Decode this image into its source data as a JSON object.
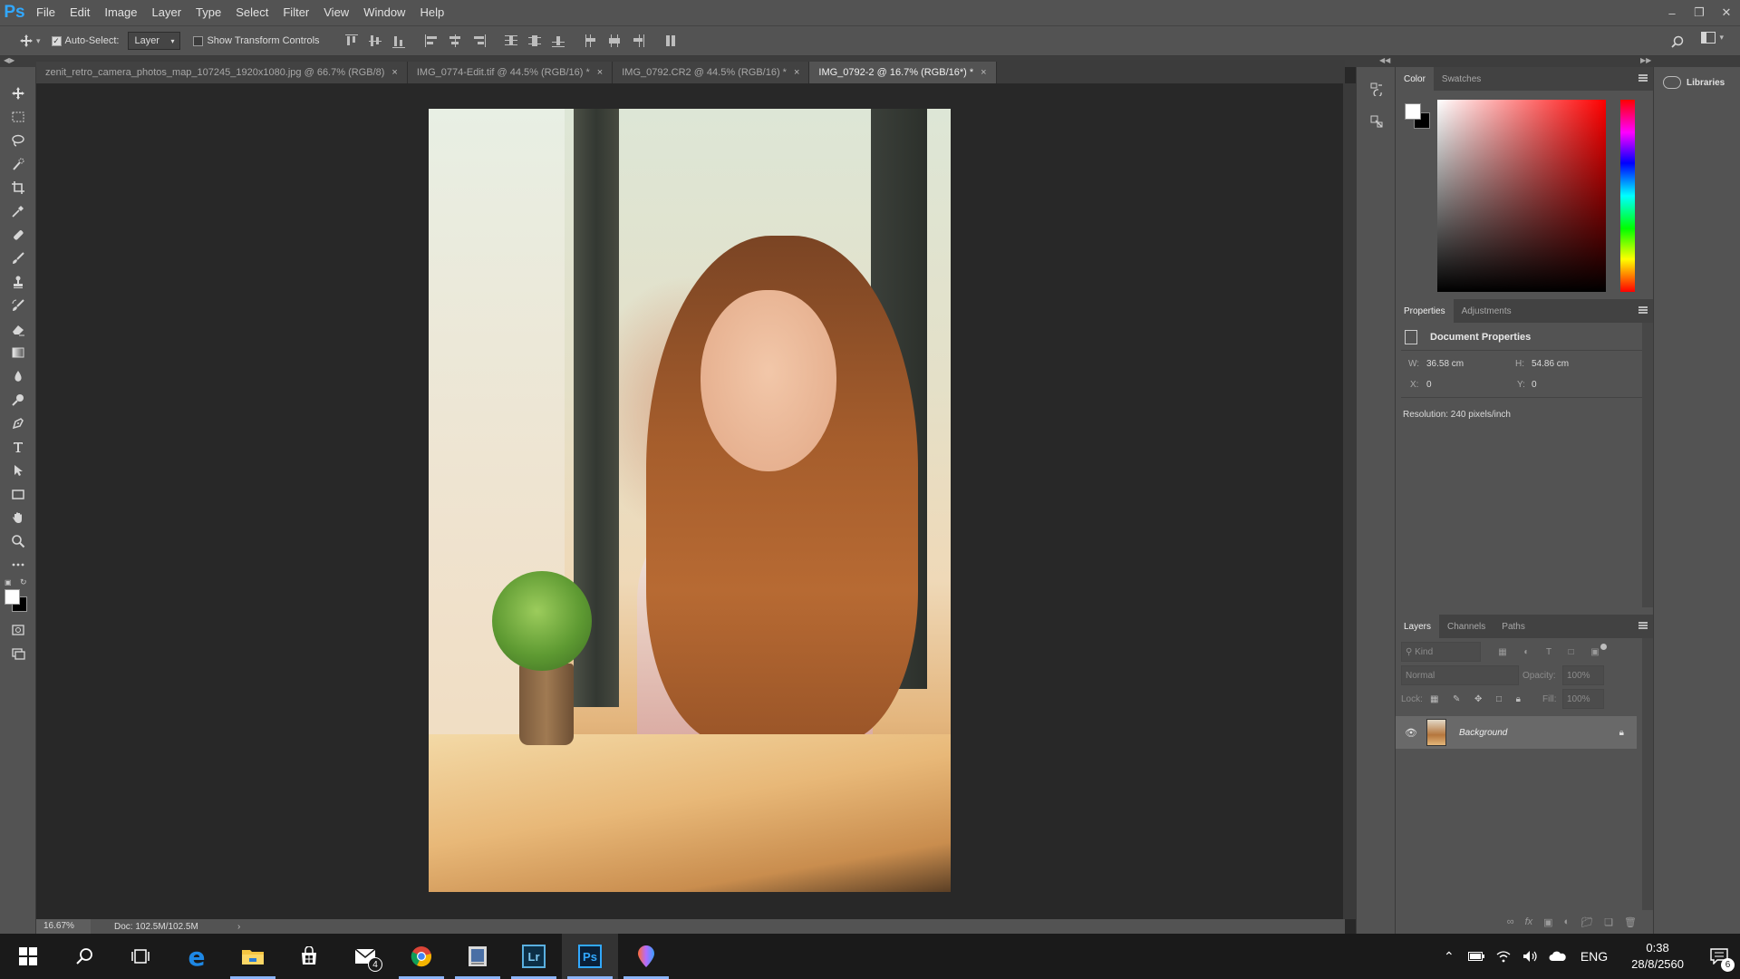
{
  "app": {
    "logo": "Ps"
  },
  "menu": [
    "File",
    "Edit",
    "Image",
    "Layer",
    "Type",
    "Select",
    "Filter",
    "View",
    "Window",
    "Help"
  ],
  "options": {
    "auto_select_label": "Auto-Select:",
    "auto_select_checked": true,
    "auto_select_target": "Layer",
    "show_transform_label": "Show Transform Controls",
    "show_transform_checked": false
  },
  "tabs": [
    {
      "label": "zenit_retro_camera_photos_map_107245_1920x1080.jpg @ 66.7% (RGB/8)",
      "active": false
    },
    {
      "label": "IMG_0774-Edit.tif @ 44.5% (RGB/16) *",
      "active": false
    },
    {
      "label": "IMG_0792.CR2 @ 44.5% (RGB/16) *",
      "active": false
    },
    {
      "label": "IMG_0792-2 @ 16.7% (RGB/16*) *",
      "active": true
    }
  ],
  "status": {
    "zoom": "16.67%",
    "doc": "Doc: 102.5M/102.5M"
  },
  "color_panel": {
    "tabs": [
      "Color",
      "Swatches"
    ],
    "foreground": "#ffffff",
    "background": "#000000"
  },
  "properties_panel": {
    "tabs": [
      "Properties",
      "Adjustments"
    ],
    "title": "Document Properties",
    "w_label": "W:",
    "w": "36.58 cm",
    "h_label": "H:",
    "h": "54.86 cm",
    "x_label": "X:",
    "x": "0",
    "y_label": "Y:",
    "y": "0",
    "resolution": "Resolution: 240 pixels/inch"
  },
  "layers_panel": {
    "tabs": [
      "Layers",
      "Channels",
      "Paths"
    ],
    "filter": "Kind",
    "blend": "Normal",
    "opacity_label": "Opacity:",
    "opacity": "100%",
    "lock_label": "Lock:",
    "fill_label": "Fill:",
    "fill": "100%",
    "layer_name": "Background"
  },
  "libraries": {
    "label": "Libraries"
  },
  "taskbar": {
    "mail_badge": "4",
    "lang": "ENG",
    "time": "0:38",
    "date": "28/8/2560",
    "notif_count": "6",
    "lr_label": "Lr",
    "ps_label": "Ps"
  }
}
